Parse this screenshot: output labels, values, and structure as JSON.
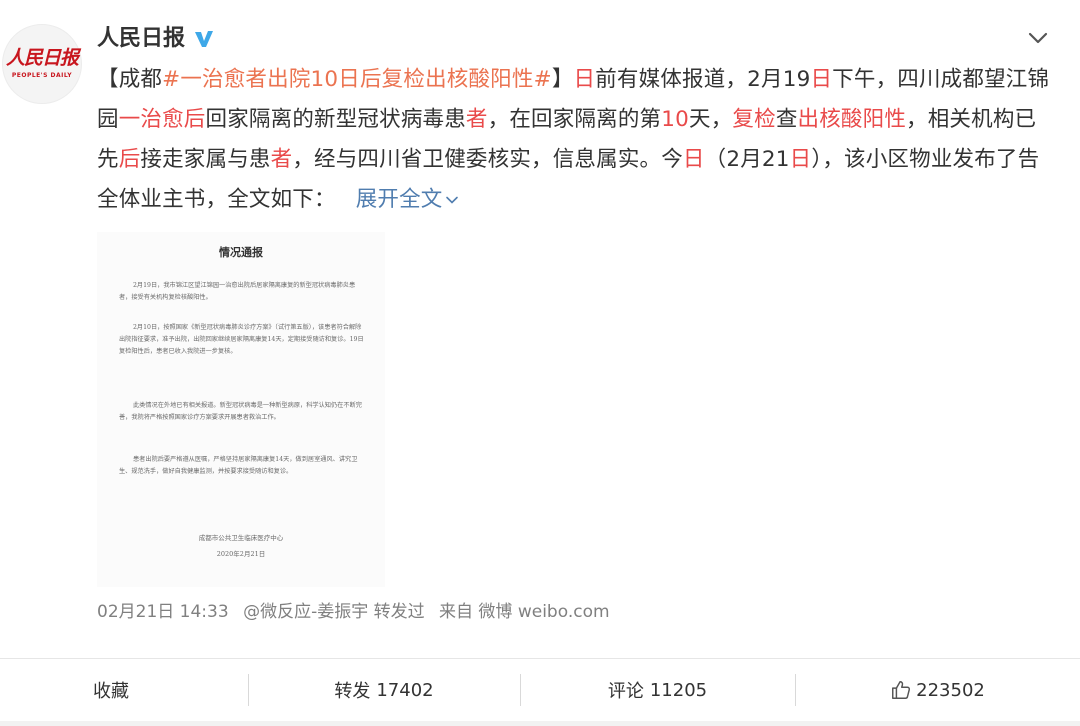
{
  "author": {
    "avatar_logo_text": "人民日报",
    "avatar_logo_en": "PEOPLE'S DAILY",
    "name": "人民日报",
    "verified_icon": "verified-v-icon"
  },
  "post": {
    "segments": [
      {
        "text": "【成都",
        "style": "normal"
      },
      {
        "text": "#一治愈者出院10日后复检出核酸阳性#",
        "style": "tag"
      },
      {
        "text": "】",
        "style": "normal"
      },
      {
        "text": "日",
        "style": "hl"
      },
      {
        "text": "前有媒体报道，2月19",
        "style": "normal"
      },
      {
        "text": "日",
        "style": "hl"
      },
      {
        "text": "下午，四川成都望江锦园",
        "style": "normal"
      },
      {
        "text": "一治愈后",
        "style": "hl"
      },
      {
        "text": "回家隔离的新型冠状病毒患",
        "style": "normal"
      },
      {
        "text": "者",
        "style": "hl"
      },
      {
        "text": "，在回家隔离的第",
        "style": "normal"
      },
      {
        "text": "10",
        "style": "hl"
      },
      {
        "text": "天，",
        "style": "normal"
      },
      {
        "text": "复检",
        "style": "hl"
      },
      {
        "text": "查",
        "style": "normal"
      },
      {
        "text": "出核酸阳性",
        "style": "hl"
      },
      {
        "text": "，相关机构已先",
        "style": "normal"
      },
      {
        "text": "后",
        "style": "hl"
      },
      {
        "text": "接走家属与患",
        "style": "normal"
      },
      {
        "text": "者",
        "style": "hl"
      },
      {
        "text": "，经与四川省卫健委核实，信息属实。今",
        "style": "normal"
      },
      {
        "text": "日",
        "style": "hl"
      },
      {
        "text": "（2月21",
        "style": "normal"
      },
      {
        "text": "日",
        "style": "hl"
      },
      {
        "text": "），该小区物业发布了告全体业主书，全文如下：",
        "style": "normal"
      }
    ],
    "expand_label": "展开全文"
  },
  "notice_image": {
    "title": "情况通报",
    "paragraphs": [
      "2月19日，我市锦江区望江锦园一治愈出院后居家隔离康复的新型冠状病毒肺炎患者，接受有关机构复检核酸阳性。",
      "2月10日，按照国家《新型冠状病毒肺炎诊疗方案》（试行第五版），该患者符合解除出院指征要求，准予出院，出院回家继续居家隔离康复14天，定期接受随访和复诊。19日复检阳性后，患者已收入我院进一步复核。",
      "此类情况在外地已有相关报道。新型冠状病毒是一种新型病原，科学认知仍在不断完善，我院将严格按照国家诊疗方案要求开展患者救治工作。",
      "患者出院后要严格遵从医嘱，严格坚持居家隔离康复14天，做到居室通风、讲究卫生、规范洗手，做好自我健康监测，并按要求接受随访和复诊。"
    ],
    "signature": "成都市公共卫生临床医疗中心",
    "date": "2020年2月21日"
  },
  "meta": {
    "timestamp": "02月21日 14:33",
    "via_user": "@微反应-姜振宇 转发过",
    "source": "来自 微博 weibo.com"
  },
  "actions": {
    "favorite_label": "收藏",
    "repost_label": "转发",
    "repost_count": "17402",
    "comment_label": "评论",
    "comment_count": "11205",
    "like_count": "223502"
  },
  "colors": {
    "highlight": "#e94a4a",
    "topic_tag": "#eb7350",
    "link_blue": "#507daf",
    "verified_blue": "#3ea8e8",
    "logo_red": "#c8161e"
  }
}
